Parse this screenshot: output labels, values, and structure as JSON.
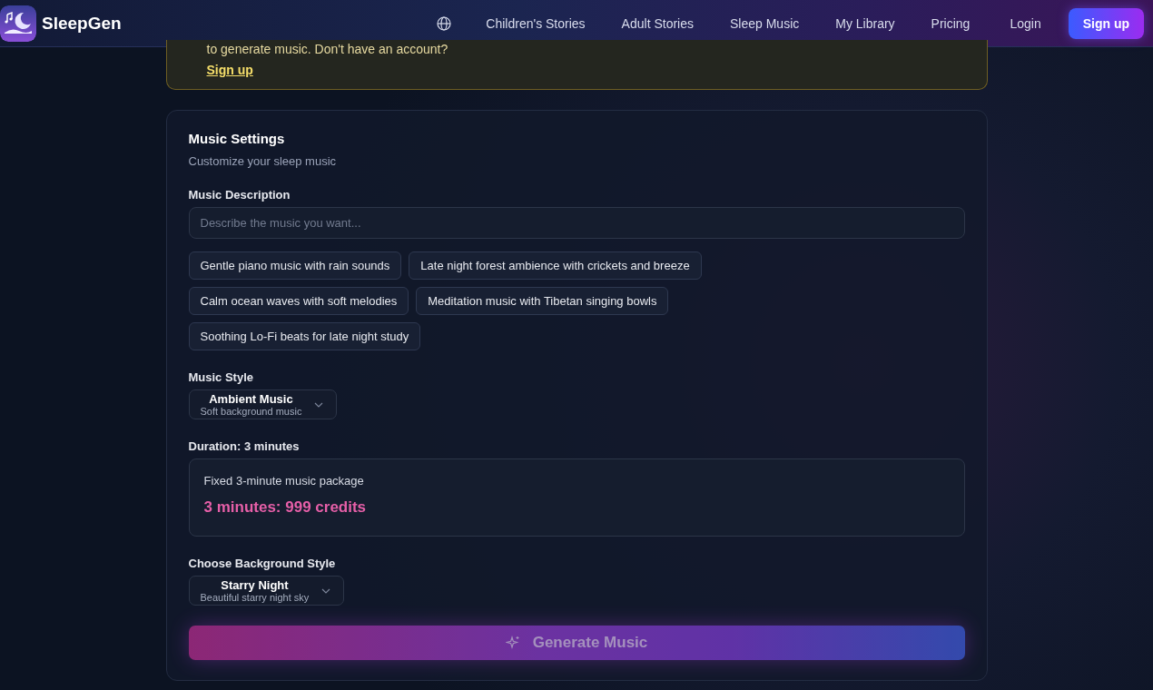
{
  "header": {
    "brand": "SleepGen",
    "nav": [
      {
        "label": "Children's Stories",
        "selected": false
      },
      {
        "label": "Adult Stories",
        "selected": false
      },
      {
        "label": "Sleep Music",
        "selected": false
      },
      {
        "label": "My Library",
        "selected": false
      },
      {
        "label": "Pricing",
        "selected": false
      }
    ],
    "login": "Login",
    "signup": "Sign up"
  },
  "notice": {
    "text": "to generate music. Don't have an account?",
    "link": "Sign up"
  },
  "settings": {
    "title": "Music Settings",
    "subtitle": "Customize your sleep music",
    "description": {
      "label": "Music Description",
      "placeholder": "Describe the music you want..."
    },
    "suggestions": [
      "Gentle piano music with rain sounds",
      "Late night forest ambience with crickets and breeze",
      "Calm ocean waves with soft melodies",
      "Meditation music with Tibetan singing bowls",
      "Soothing Lo-Fi beats for late night study"
    ],
    "style": {
      "label": "Music Style",
      "value": "Ambient Music",
      "hint": "Soft background music"
    },
    "duration": {
      "label": "Duration: 3 minutes",
      "note": "Fixed 3-minute music package",
      "price": "3 minutes: 999 credits"
    },
    "background": {
      "label": "Choose Background Style",
      "value": "Starry Night",
      "hint": "Beautiful starry night sky"
    },
    "generate": {
      "label": "Generate Music",
      "disabled": true
    }
  }
}
